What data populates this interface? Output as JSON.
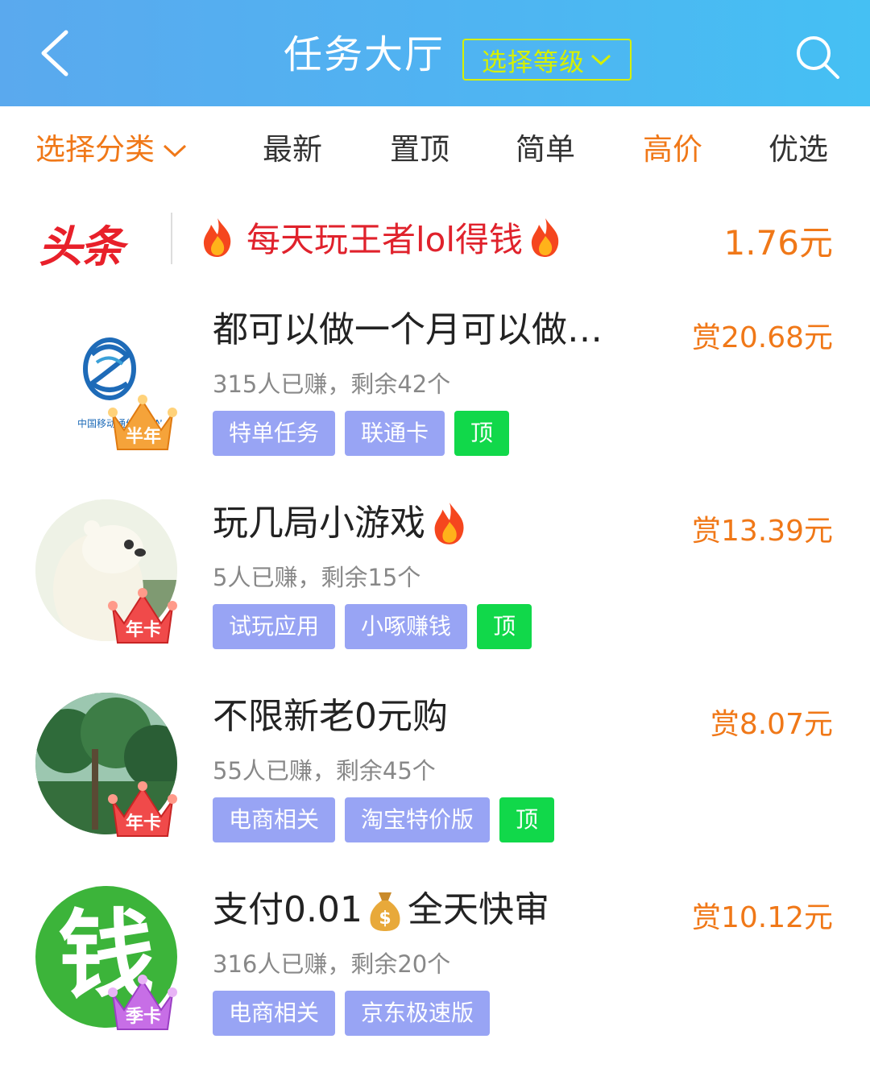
{
  "header": {
    "title": "任务大厅",
    "level_label": "选择等级",
    "back_icon": "chevron-left-icon",
    "search_icon": "search-icon"
  },
  "tabs": {
    "category": "选择分类",
    "items": [
      "最新",
      "置顶",
      "简单",
      "高价",
      "优选"
    ],
    "active": "高价"
  },
  "headline": {
    "brand": "头条",
    "text": "每天玩王者lol得钱",
    "price": "1.76元"
  },
  "tasks": [
    {
      "title": "都可以做一个月可以做…",
      "price": "赏20.68元",
      "stats": "315人已赚，剩余42个",
      "tags": [
        "特单任务",
        "联通卡"
      ],
      "pinned_label": "顶",
      "badge": "半年",
      "avatar_text": "中国移动通信 CHINA MOBILE"
    },
    {
      "title": "玩几局小游戏",
      "price": "赏13.39元",
      "stats": "5人已赚，剩余15个",
      "tags": [
        "试玩应用",
        "小啄赚钱"
      ],
      "pinned_label": "顶",
      "badge": "年卡"
    },
    {
      "title": "不限新老0元购",
      "price": "赏8.07元",
      "stats": "55人已赚，剩余45个",
      "tags": [
        "电商相关",
        "淘宝特价版"
      ],
      "pinned_label": "顶",
      "badge": "年卡"
    },
    {
      "title_a": "支付0.01",
      "title_b": "全天快审",
      "price": "赏10.12元",
      "stats": "316人已赚，剩余20个",
      "tags": [
        "电商相关",
        "京东极速版"
      ],
      "badge": "季卡",
      "avatar_text": "钱"
    }
  ],
  "colors": {
    "accent_orange": "#f07818",
    "headline_red": "#e0222c",
    "tag_blue": "#98a4f4",
    "pin_green": "#11d84a",
    "header_blue": "#4fb4f2",
    "level_yellow": "#d6f000"
  }
}
